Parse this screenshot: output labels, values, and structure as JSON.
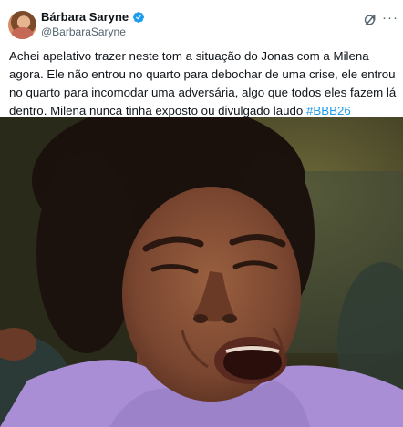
{
  "author": {
    "display_name": "Bárbara Saryne",
    "handle": "@BarbaraSaryne",
    "verified": true
  },
  "tweet": {
    "text": "Achei apelativo trazer neste tom a situação do Jonas com a Milena agora. Ele não entrou no quarto para debochar de uma crise, ele entrou no quarto para incomodar uma adversária, algo que todos eles fazem lá dentro. Milena nunca tinha exposto ou divulgado laudo ",
    "hashtag": "#BBB26"
  },
  "icons": {
    "verified": "verified-badge-icon",
    "grok": "grok-icon",
    "more": "more-options-icon"
  },
  "colors": {
    "accent": "#1d9bf0",
    "secondary_text": "#536471"
  }
}
